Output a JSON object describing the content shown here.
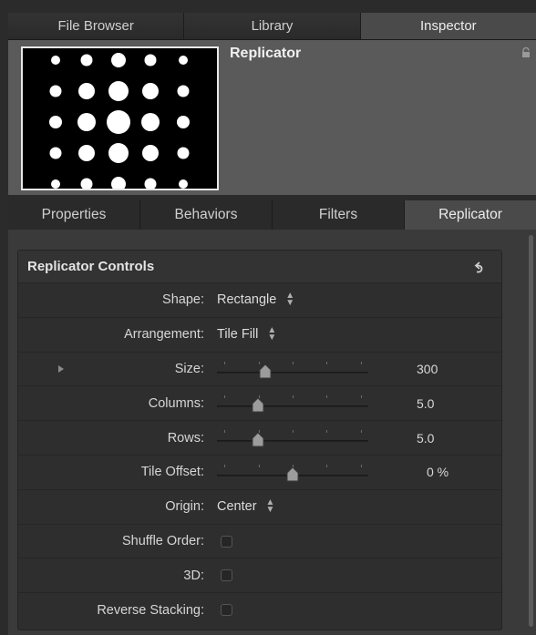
{
  "top_tabs": [
    {
      "label": "File Browser",
      "active": false
    },
    {
      "label": "Library",
      "active": false
    },
    {
      "label": "Inspector",
      "active": true
    }
  ],
  "object": {
    "title": "Replicator"
  },
  "sub_tabs": [
    {
      "label": "Properties",
      "active": false
    },
    {
      "label": "Behaviors",
      "active": false
    },
    {
      "label": "Filters",
      "active": false
    },
    {
      "label": "Replicator",
      "active": true
    }
  ],
  "group": {
    "title": "Replicator Controls",
    "rows": {
      "shape": {
        "label": "Shape:",
        "value": "Rectangle"
      },
      "arrangement": {
        "label": "Arrangement:",
        "value": "Tile Fill"
      },
      "size": {
        "label": "Size:",
        "value": "300",
        "fraction": 0.32
      },
      "columns": {
        "label": "Columns:",
        "value": "5.0",
        "fraction": 0.27
      },
      "rows": {
        "label": "Rows:",
        "value": "5.0",
        "fraction": 0.27
      },
      "tile_offset": {
        "label": "Tile Offset:",
        "value": "0 %",
        "fraction": 0.5
      },
      "origin": {
        "label": "Origin:",
        "value": "Center"
      },
      "shuffle_order": {
        "label": "Shuffle Order:",
        "checked": false
      },
      "three_d": {
        "label": "3D:",
        "checked": false
      },
      "reverse_stacking": {
        "label": "Reverse Stacking:",
        "checked": false
      }
    }
  },
  "colors": {
    "active_tab": "#4a4a4a",
    "panel": "#3a3a3a",
    "header": "#5a5a5a"
  }
}
